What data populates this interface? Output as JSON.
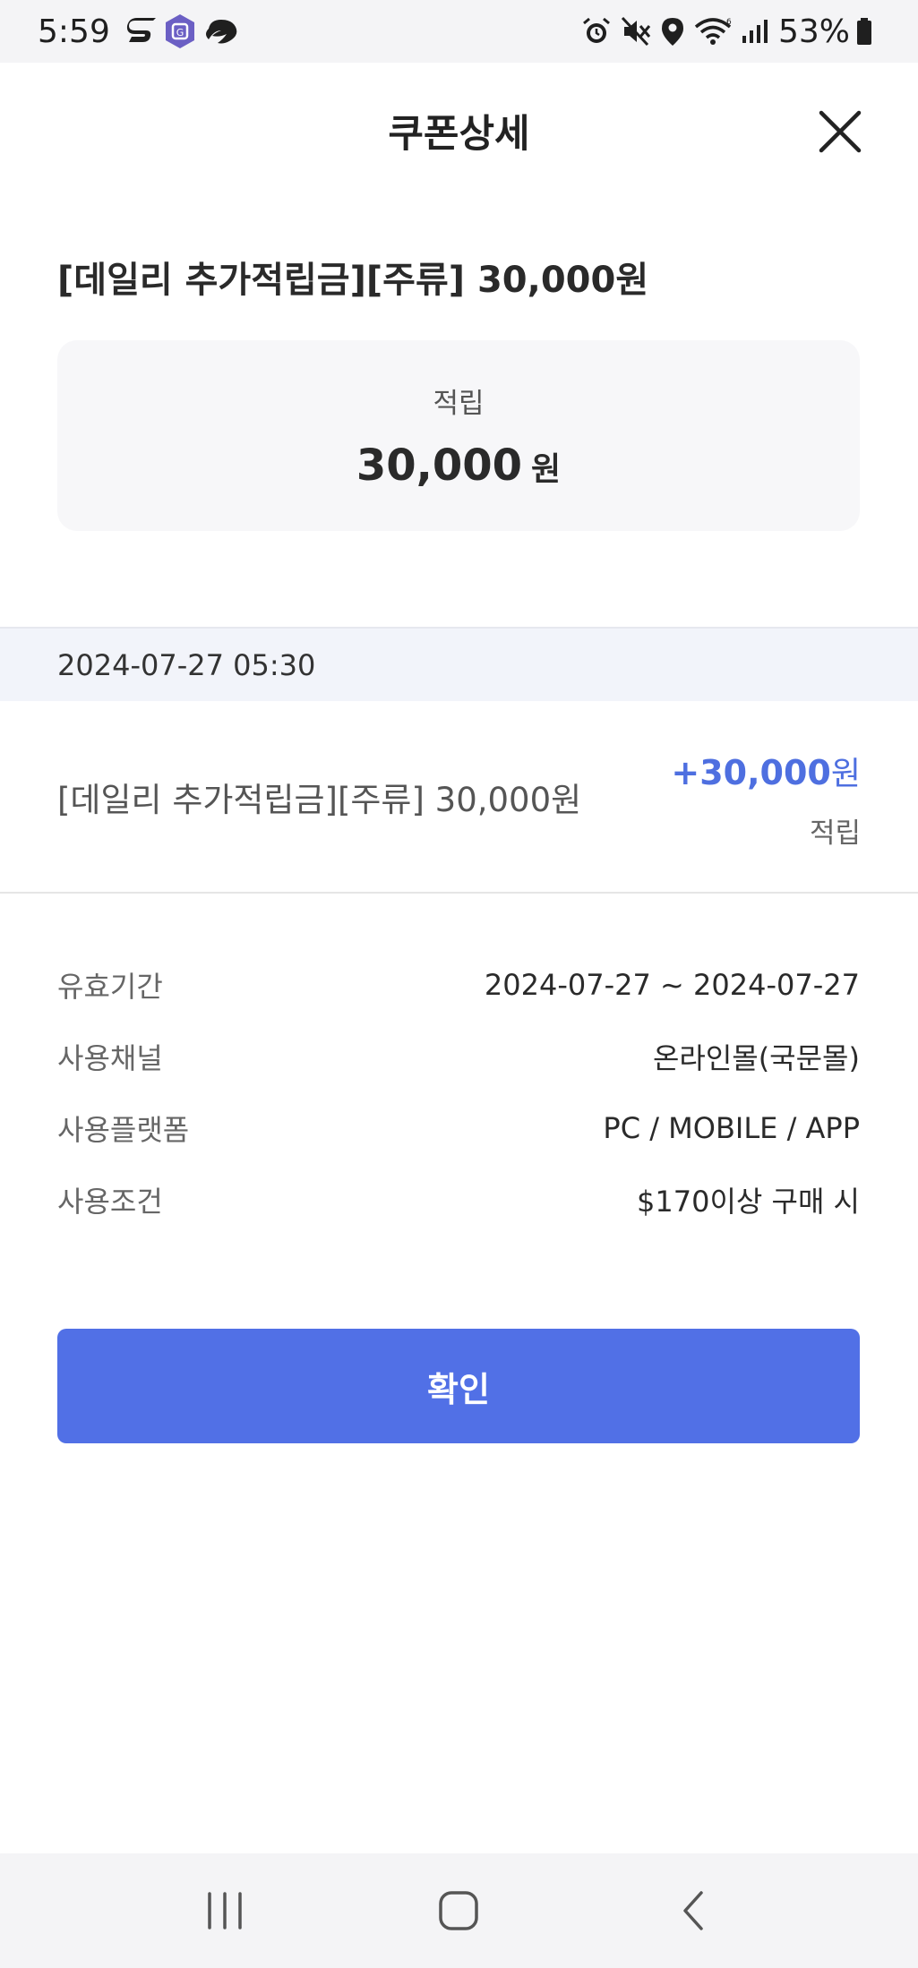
{
  "status_bar": {
    "time": "5:59",
    "battery": "53%",
    "left_icons": [
      "s-app-icon",
      "shield-app-icon",
      "cloud-app-icon"
    ],
    "right_icons": [
      "alarm-icon",
      "mute-icon",
      "location-icon",
      "wifi-icon",
      "signal-icon",
      "battery-icon"
    ]
  },
  "header": {
    "title": "쿠폰상세",
    "close_icon": "close-icon"
  },
  "coupon": {
    "title": "[데일리 추가적립금][주류] 30,000원",
    "summary_label": "적립",
    "summary_value": "30,000",
    "summary_unit": "원"
  },
  "history": {
    "date": "2024-07-27 05:30",
    "item_name": "[데일리 추가적립금][주류] 30,000원",
    "amount": "+30,000",
    "amount_unit": "원",
    "type": "적립"
  },
  "details": [
    {
      "label": "유효기간",
      "value": "2024-07-27 ~ 2024-07-27"
    },
    {
      "label": "사용채널",
      "value": "온라인몰(국문몰)"
    },
    {
      "label": "사용플랫폼",
      "value": "PC / MOBILE / APP"
    },
    {
      "label": "사용조건",
      "value": "$170이상 구매 시"
    }
  ],
  "confirm_button": {
    "label": "확인"
  },
  "colors": {
    "accent": "#5170e6",
    "amount_blue": "#4e6fe0"
  },
  "nav_bar": {
    "icons": [
      "recent-apps-icon",
      "home-icon",
      "back-icon"
    ]
  }
}
